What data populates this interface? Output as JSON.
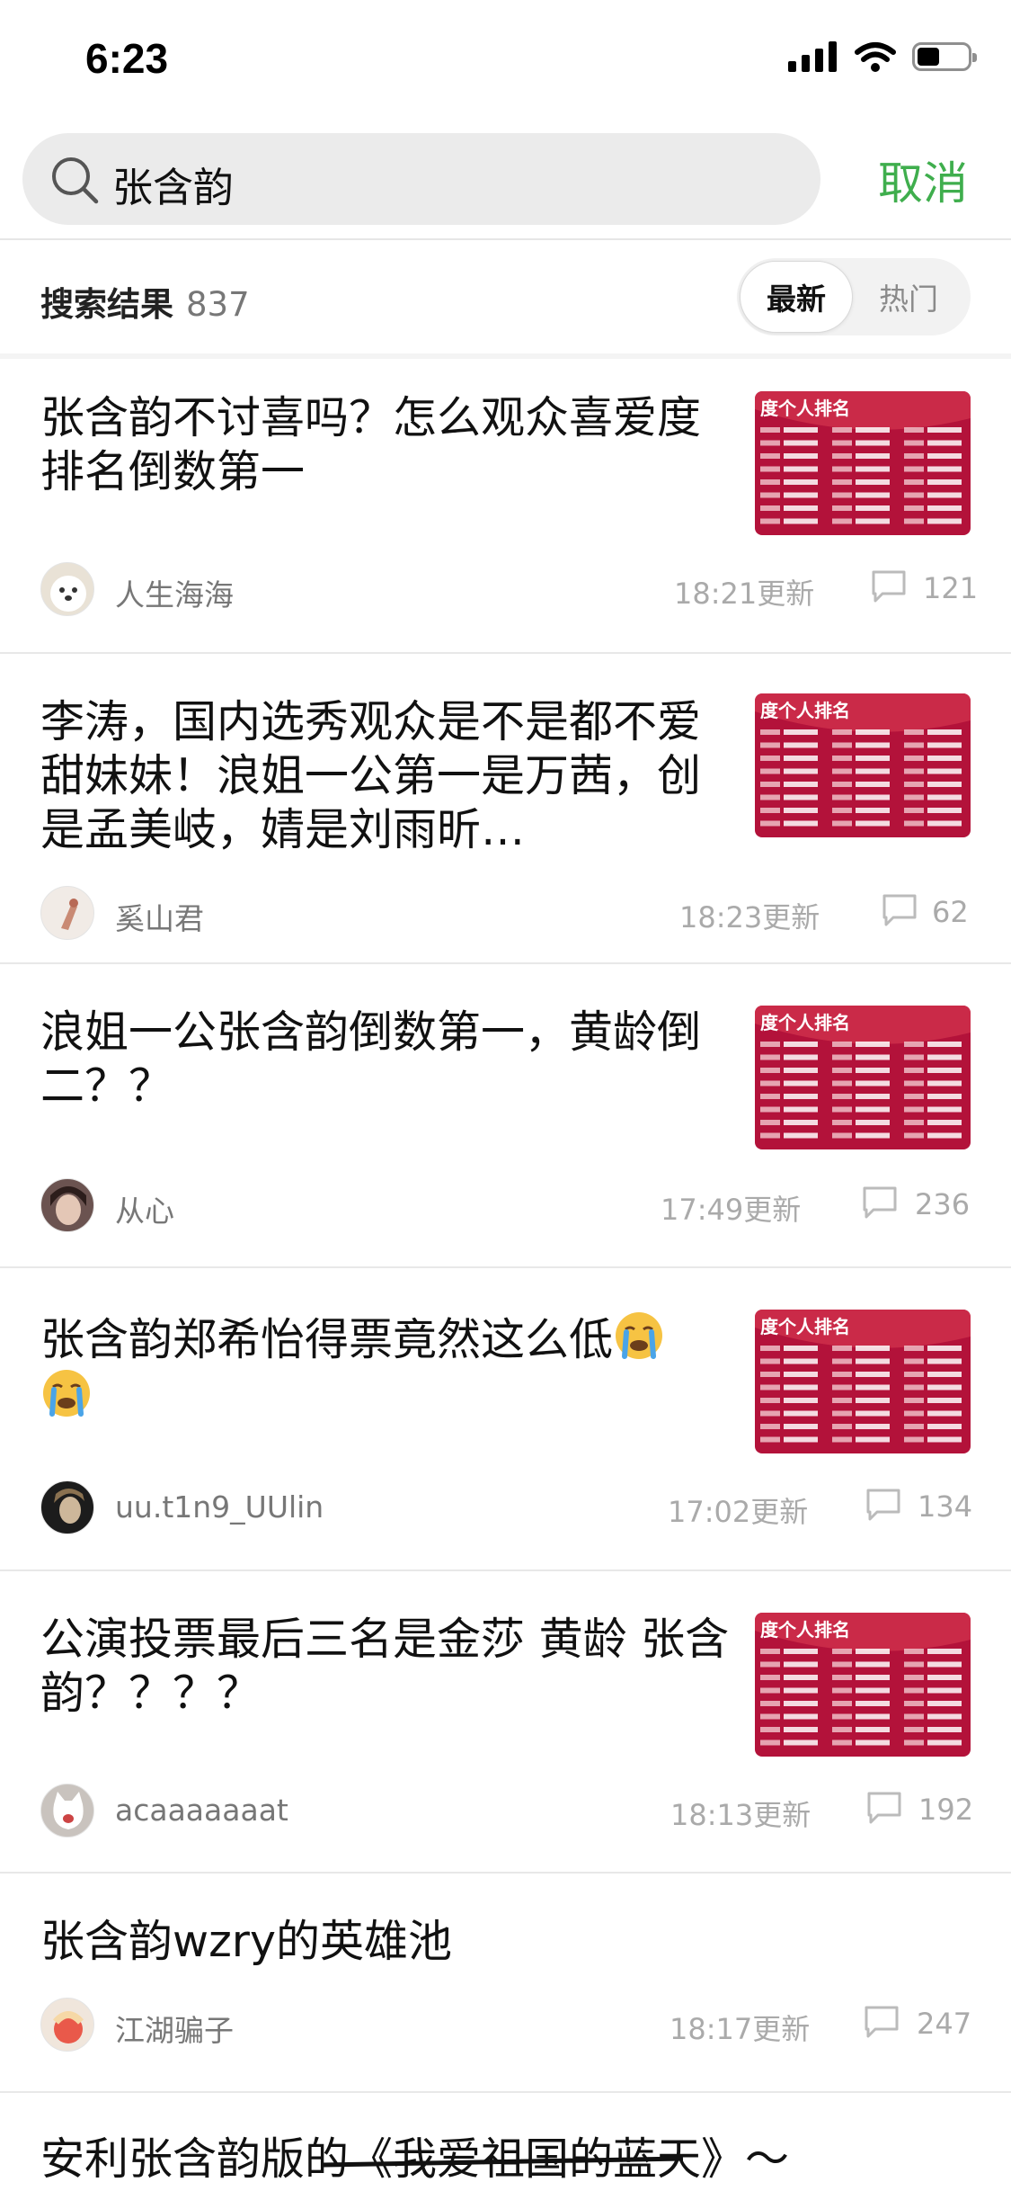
{
  "status_bar": {
    "time": "6:23"
  },
  "search": {
    "query": "张含韵",
    "cancel_label": "取消"
  },
  "results": {
    "label": "搜索结果",
    "count": "837",
    "sort_latest": "最新",
    "sort_hot": "热门"
  },
  "items": [
    {
      "title": "张含韵不讨喜吗？怎么观众喜爱度排名倒数第一",
      "author": "人生海海",
      "time": "18:21更新",
      "comments": "121"
    },
    {
      "title": "李涛，国内选秀观众是不是都不爱甜妹妹！浪姐一公第一是万茜，创是孟美岐，婧是刘雨昕…",
      "author": "奚山君",
      "time": "18:23更新",
      "comments": "62"
    },
    {
      "title": "浪姐一公张含韵倒数第一，黄龄倒二？？",
      "author": "从心",
      "time": "17:49更新",
      "comments": "236"
    },
    {
      "title": "张含韵郑希怡得票竟然这么低",
      "author": "uu.t1n9_UUlin",
      "time": "17:02更新",
      "comments": "134"
    },
    {
      "title": "公演投票最后三名是金莎 黄龄 张含韵？？？？",
      "author": "acaaaaaaat",
      "time": "18:13更新",
      "comments": "192"
    },
    {
      "title": "张含韵wzry的英雄池",
      "author": "江湖骗子",
      "time": "18:17更新",
      "comments": "247"
    },
    {
      "title": "安利张含韵版的《我爱祖国的蓝天》～"
    }
  ],
  "thumb_heading": "度个人排名",
  "colors": {
    "accent": "#3fae4d",
    "thumb_red": "#b3123a"
  },
  "icons": [
    "search-icon",
    "comment-icon",
    "cry-emoji-icon",
    "signal-icon",
    "wifi-icon",
    "battery-icon"
  ],
  "battery_level": 0.45
}
